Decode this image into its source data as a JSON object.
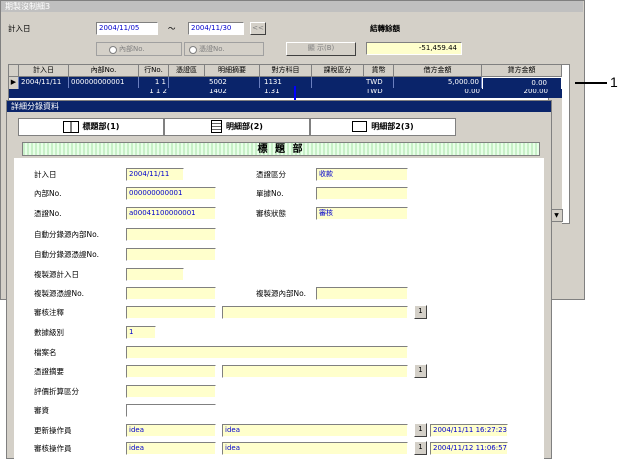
{
  "background_window": {
    "title": "期製沒制細3",
    "date_label": "計入日",
    "date_from": "2004/11/05",
    "date_tilde": "～",
    "date_to": "2004/11/30",
    "date_btn": "<<",
    "balance_label": "結轉餘額",
    "balance_value": "-51,459.44",
    "radio_internal": "內部No.",
    "radio_voucher": "憑證No.",
    "display_btn": "顯 示(B)"
  },
  "grid": {
    "headers": [
      "計入日",
      "內部No.",
      "行No.",
      "憑證區",
      "明細摘要",
      "對方科目",
      "課稅區分",
      "貨幣",
      "借方金額",
      "貸方金額"
    ],
    "row1": [
      "2004/11/11",
      "000000000001",
      "1",
      "1",
      "5002",
      "1131",
      "",
      "TWD",
      "5,000.00",
      "0.00"
    ],
    "row2": [
      "",
      "",
      "1 1 2",
      "",
      "1402",
      "1.31",
      "",
      "TWD",
      "0.00",
      "200.00"
    ]
  },
  "detail": {
    "title": "詳細分錄資料",
    "tabs": [
      "標題部(1)",
      "明細部(2)",
      "明細部2(3)"
    ],
    "header_bar": "標 題 部",
    "fields": {
      "date_label": "計入日",
      "date_value": "2004/11/11",
      "vclass_label": "憑證區分",
      "vclass_value": "收款",
      "internal_label": "內部No.",
      "internal_value": "000000000001",
      "doc_label": "單據No.",
      "doc_value": "",
      "voucher_label": "憑證No.",
      "voucher_value": "a00041100000001",
      "review_label": "審核狀態",
      "review_value": "審核",
      "auto_internal_label": "自動分錄源內部No.",
      "auto_voucher_label": "自動分錄源憑證No.",
      "copy_date_label": "複製源計入日",
      "copy_voucher_label": "複製源憑證No.",
      "copy_internal_label": "複製源內部No.",
      "review_note_label": "審核注釋",
      "level_label": "數據級別",
      "level_value": "1",
      "file_label": "檔案名",
      "summary_label": "憑證摘要",
      "eval_label": "評價折算區分",
      "approve_label": "審資",
      "updater_label": "更新操作員",
      "updater_value1": "idea",
      "updater_value2": "idea",
      "updater_time": "2004/11/11 16:27:23",
      "reviewer_label": "審核操作員",
      "reviewer_value1": "idea",
      "reviewer_value2": "idea",
      "reviewer_time": "2004/11/12 11:06:57",
      "lookup_btn": "1"
    }
  },
  "callout": {
    "number": "1"
  },
  "colors": {
    "window": "#d4d0c8",
    "field": "#ffffcc",
    "selection": "#0a246a",
    "callout": "#0000ff"
  }
}
